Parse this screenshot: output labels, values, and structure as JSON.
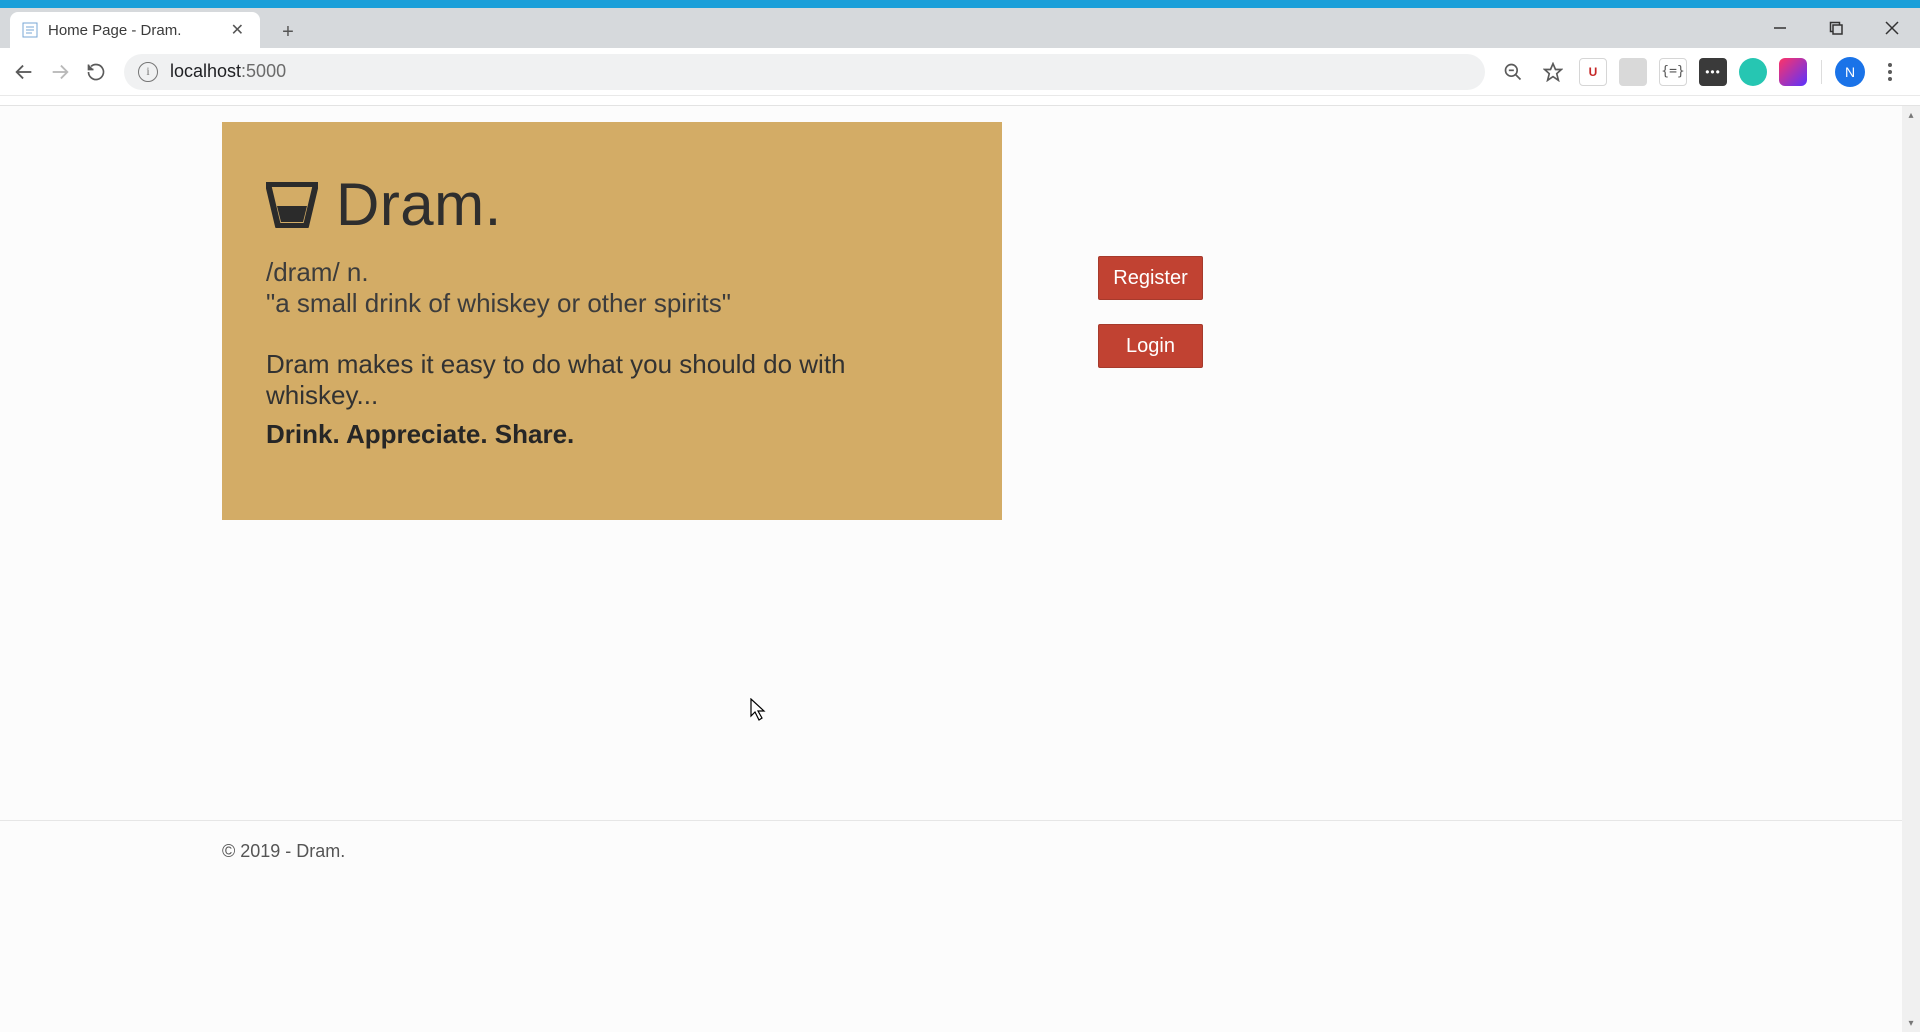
{
  "browser": {
    "tab_title": "Home Page - Dram.",
    "url_host": "localhost",
    "url_port": ":5000",
    "avatar_initial": "N",
    "ext_braces": "{=}",
    "ext_dots": "•••",
    "ext_shield": "U"
  },
  "hero": {
    "brand": "Dram.",
    "pronunciation": "/dram/ n.",
    "definition": "\"a small drink of whiskey or other spirits\"",
    "lead": "Dram makes it easy to do what you should do with whiskey...",
    "tagline": "Drink. Appreciate. Share."
  },
  "cta": {
    "register": "Register",
    "login": "Login"
  },
  "footer": {
    "text": "© 2019 - Dram."
  }
}
